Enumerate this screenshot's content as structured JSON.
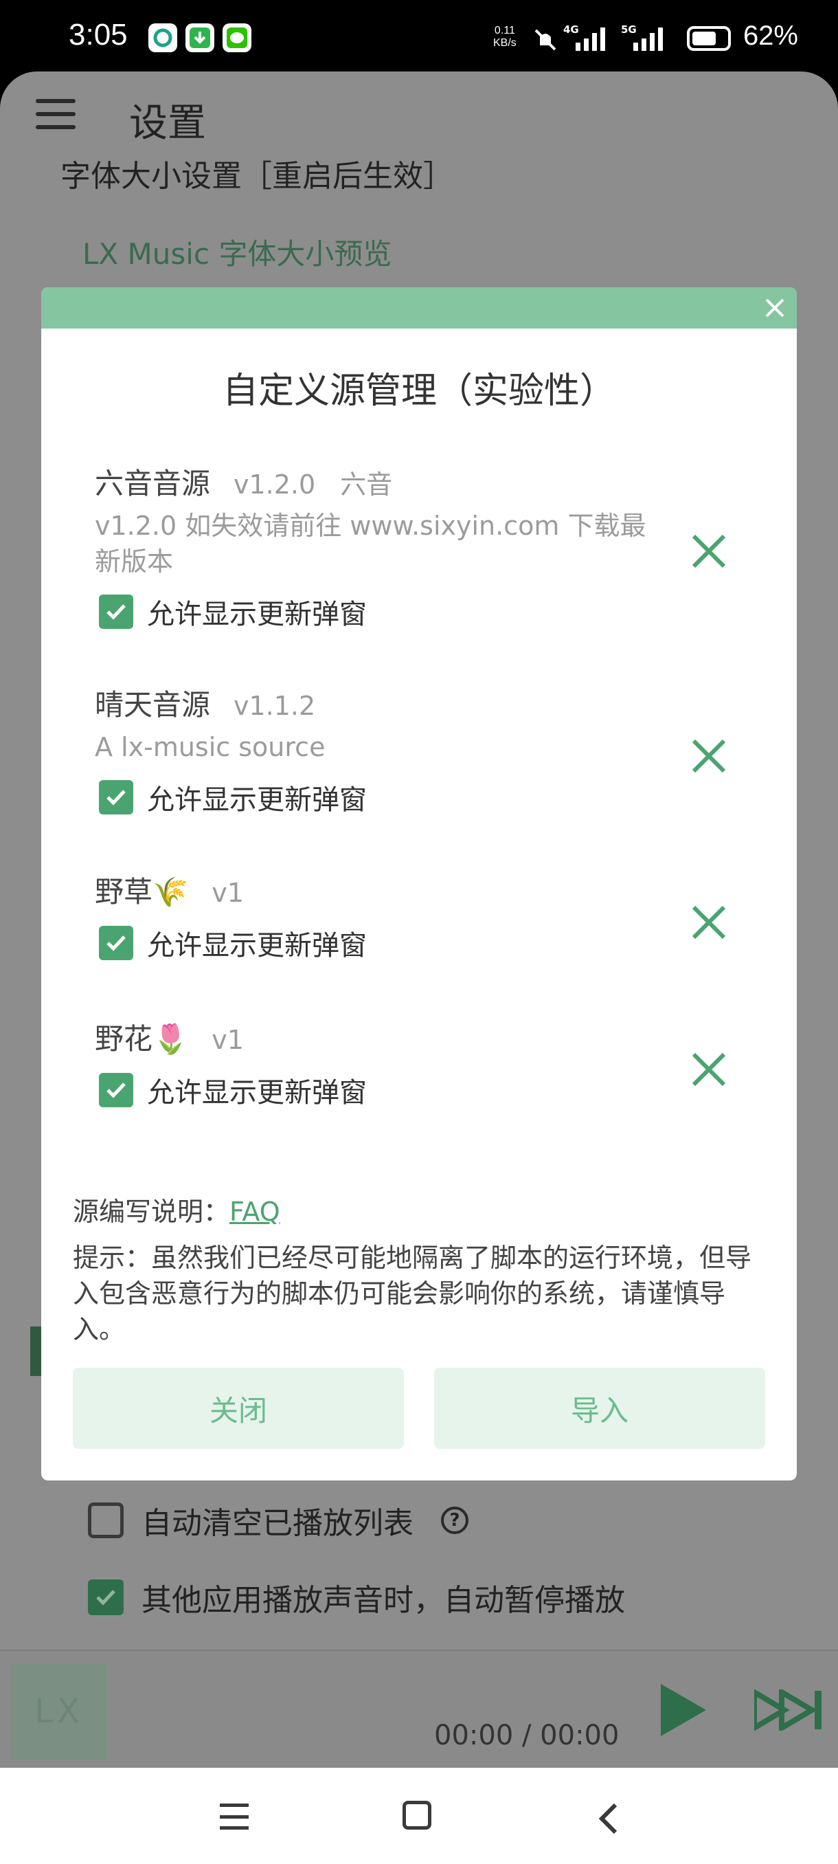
{
  "status_bar": {
    "time": "3:05",
    "speed_value": "0.11",
    "speed_unit": "KB/s",
    "net1": "4G",
    "net2": "5G",
    "battery": "62%"
  },
  "header": {
    "title": "设置"
  },
  "background": {
    "font_size_label": "字体大小设置［重启后生效］",
    "font_preview": "LX Music 字体大小预览",
    "auto_clear_label": "自动清空已播放列表",
    "help_glyph": "?",
    "auto_pause_label": "其他应用播放声音时，自动暂停播放"
  },
  "player": {
    "cover_text": "LX",
    "time": "00:00 / 00:00"
  },
  "dialog": {
    "title": "自定义源管理（实验性）",
    "sources": [
      {
        "name": "六音音源",
        "version": "v1.2.0",
        "author": "六音",
        "description": "v1.2.0 如失效请前往 www.sixyin.com 下载最新版本",
        "allow_label": "允许显示更新弹窗",
        "allow_checked": true
      },
      {
        "name": "晴天音源",
        "version": "v1.1.2",
        "author": "",
        "description": "A lx-music source",
        "allow_label": "允许显示更新弹窗",
        "allow_checked": true
      },
      {
        "name": "野草🌾",
        "version": "v1",
        "author": "",
        "description": "",
        "allow_label": "允许显示更新弹窗",
        "allow_checked": true
      },
      {
        "name": "野花🌷",
        "version": "v1",
        "author": "",
        "description": "",
        "allow_label": "允许显示更新弹窗",
        "allow_checked": true
      }
    ],
    "faq_prefix": "源编写说明：",
    "faq_link": "FAQ",
    "tip": "提示：虽然我们已经尽可能地隔离了脚本的运行环境，但导入包含恶意行为的脚本仍可能会影响你的系统，请谨慎导入。",
    "close_button": "关闭",
    "import_button": "导入"
  },
  "colors": {
    "accent": "#4aa46f",
    "dialog_header": "#85c5a0",
    "button_bg": "#e6f4ec",
    "button_text": "#6dbb8d"
  }
}
